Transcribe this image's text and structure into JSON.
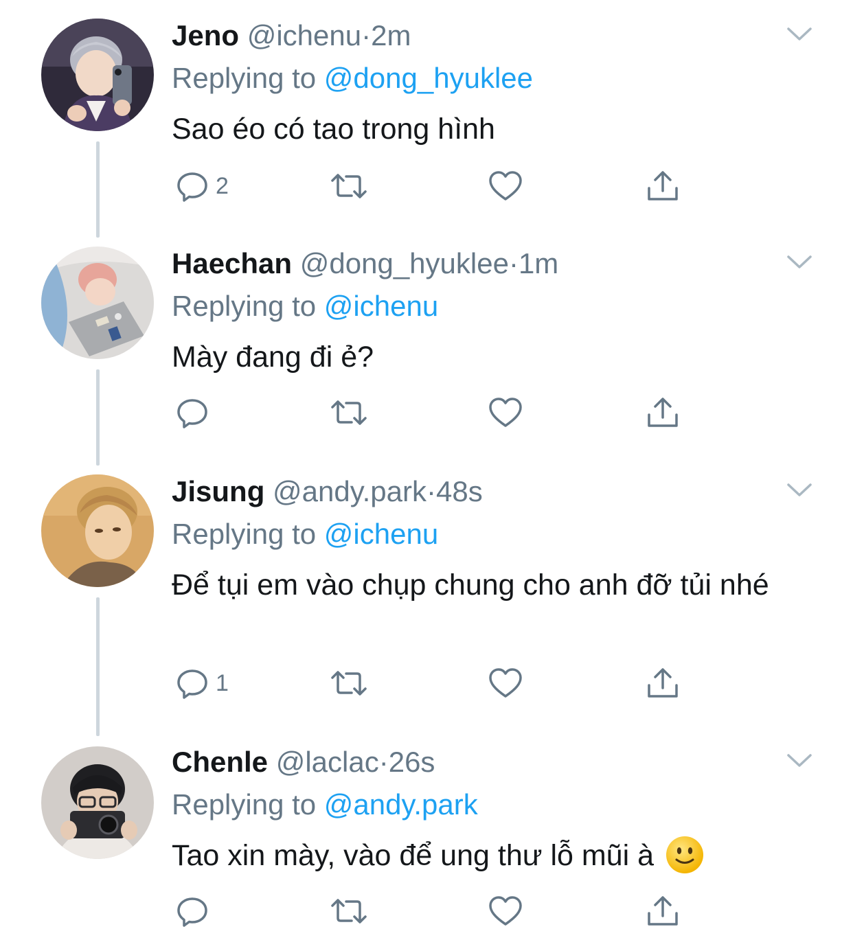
{
  "thread": {
    "tweets": [
      {
        "name": "Jeno",
        "handle": "@ichenu",
        "dot": "·",
        "time": "2m",
        "replying_label": "Replying to",
        "replying_to": "@dong_hyuklee",
        "text": "Sao éo có tao trong hình",
        "reply_count": "2",
        "avatar_color": "#3b3446"
      },
      {
        "name": "Haechan",
        "handle": "@dong_hyuklee",
        "dot": "·",
        "time": "1m",
        "replying_label": "Replying to",
        "replying_to": "@ichenu",
        "text": "Mày đang đi ẻ?",
        "reply_count": "",
        "avatar_color": "#e9e6e4"
      },
      {
        "name": "Jisung",
        "handle": "@andy.park",
        "dot": "·",
        "time": "48s",
        "replying_label": "Replying to",
        "replying_to": "@ichenu",
        "text": "Để tụi em vào chụp chung cho anh đỡ tủi nhé",
        "reply_count": "1",
        "avatar_color": "#d9a866"
      },
      {
        "name": "Chenle",
        "handle": "@laclac",
        "dot": "·",
        "time": "26s",
        "replying_label": "Replying to",
        "replying_to": "@andy.park",
        "text": "Tao xin mày, vào để ung thư lỗ mũi à",
        "reply_count": "",
        "avatar_color": "#cfcac6"
      }
    ]
  },
  "icons": {
    "reply": "reply-icon",
    "retweet": "retweet-icon",
    "like": "heart-icon",
    "share": "share-icon",
    "more": "chevron-down-icon",
    "emoji": "slightly-smiling-face-emoji"
  },
  "colors": {
    "link": "#1da1f2",
    "secondary_text": "#657786",
    "primary_text": "#14171a",
    "thread_line": "#cdd6dd"
  }
}
